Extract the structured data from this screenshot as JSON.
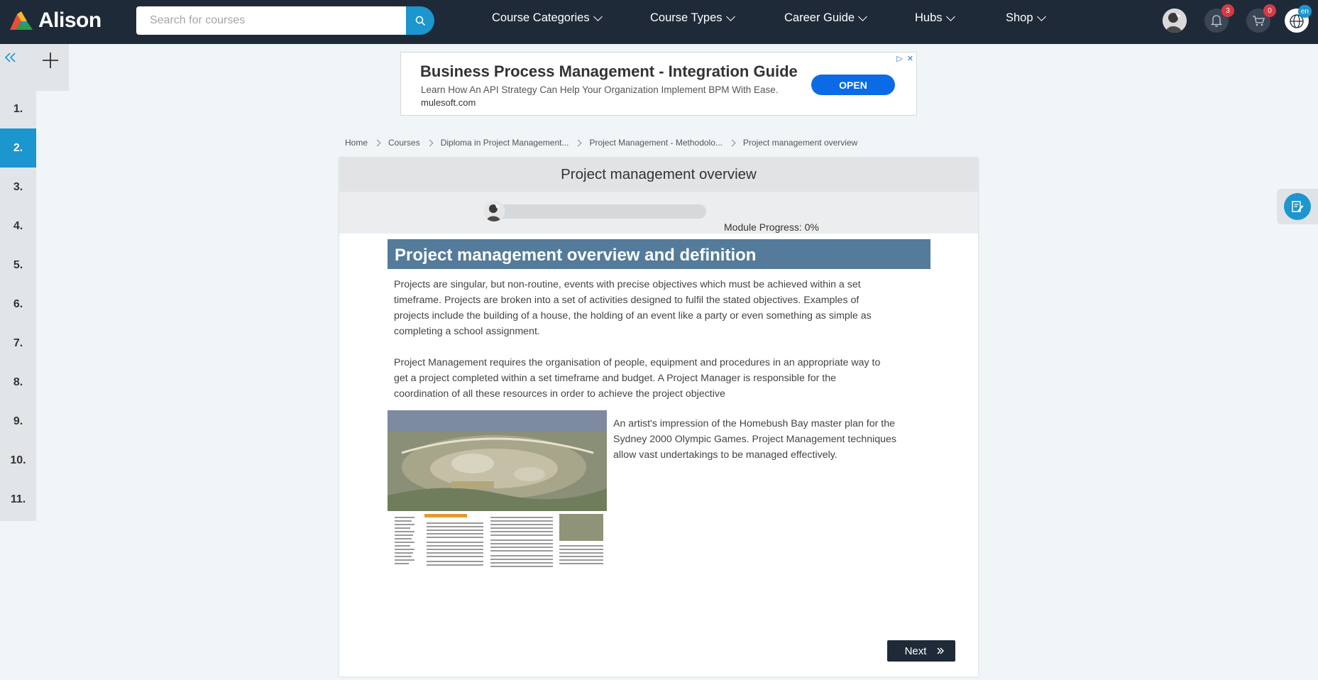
{
  "brand": {
    "name": "Alison"
  },
  "search": {
    "placeholder": "Search for courses"
  },
  "nav": [
    {
      "label": "Course Categories"
    },
    {
      "label": "Course Types"
    },
    {
      "label": "Career Guide"
    },
    {
      "label": "Hubs"
    },
    {
      "label": "Shop"
    }
  ],
  "header_icons": {
    "notifications_count": "3",
    "cart_count": "0",
    "language_code": "en"
  },
  "sidebar": {
    "items": [
      "1.",
      "2.",
      "3.",
      "4.",
      "5.",
      "6.",
      "7.",
      "8.",
      "9.",
      "10.",
      "11."
    ],
    "active_index": 1
  },
  "ad": {
    "title": "Business Process Management - Integration Guide",
    "description": "Learn How An API Strategy Can Help Your Organization Implement BPM With Ease.",
    "url": "mulesoft.com",
    "button": "OPEN"
  },
  "breadcrumb": [
    "Home",
    "Courses",
    "Diploma in Project Management...",
    "Project Management - Methodolo...",
    "Project management overview"
  ],
  "module": {
    "title": "Project management overview",
    "progress_label": "Module Progress: 0%",
    "progress_fraction": 0
  },
  "content": {
    "heading": "Project management overview and definition",
    "paragraph1": "Projects are singular, but non-routine, events with precise objectives which must be achieved within a set timeframe. Projects are broken into a set of activities designed to fulfil the stated objectives. Examples of projects include the building of a house, the holding of an event like a party or even something as simple as completing a school assignment.",
    "paragraph2": "Project Management requires the organisation of people, equipment and procedures in an appropriate way to get a project completed within a set timeframe and budget. A Project Manager is responsible for the coordination of all these resources in order to achieve the project objective",
    "caption": "An artist's impression of the Homebush Bay master plan for the Sydney 2000 Olympic Games. Project Management techniques allow vast undertakings to be managed effectively."
  },
  "actions": {
    "next": "Next"
  },
  "colors": {
    "topbar": "#1f2a38",
    "accent": "#1b96cf",
    "heading_bg": "#557b9b",
    "badge": "#d93944"
  }
}
